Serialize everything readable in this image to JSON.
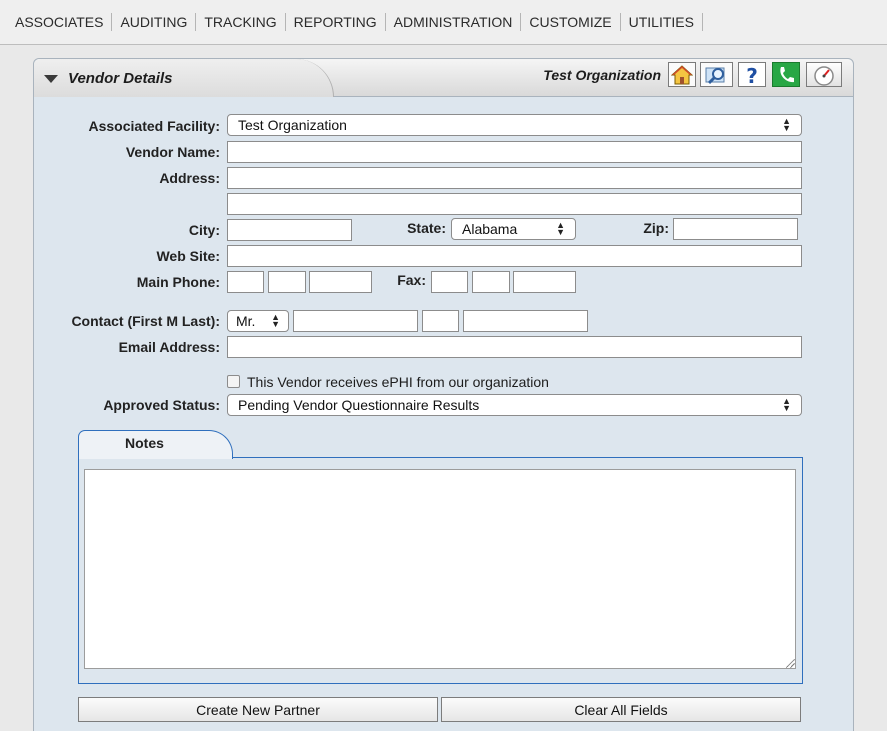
{
  "nav": {
    "items": [
      "ASSOCIATES",
      "AUDITING",
      "TRACKING",
      "REPORTING",
      "ADMINISTRATION",
      "CUSTOMIZE",
      "UTILITIES"
    ]
  },
  "panel": {
    "title": "Vendor Details",
    "organization": "Test Organization",
    "icons": [
      "home-icon",
      "search-icon",
      "help-icon",
      "phone-icon",
      "dashboard-icon"
    ]
  },
  "form": {
    "labels": {
      "facility": "Associated Facility:",
      "vendor_name": "Vendor Name:",
      "address": "Address:",
      "city": "City:",
      "state": "State:",
      "zip": "Zip:",
      "website": "Web Site:",
      "main_phone": "Main Phone:",
      "fax": "Fax:",
      "contact": "Contact (First M Last):",
      "email": "Email Address:",
      "approved_status": "Approved Status:"
    },
    "facility_value": "Test Organization",
    "state_value": "Alabama",
    "salutation_value": "Mr.",
    "ephi_checkbox_label": "This Vendor receives ePHI from our organization",
    "ephi_checked": false,
    "approved_status_value": "Pending Vendor Questionnaire Results"
  },
  "notes": {
    "tab_label": "Notes",
    "value": ""
  },
  "buttons": {
    "create": "Create New Partner",
    "clear": "Clear All Fields"
  },
  "colors": {
    "panel_bg": "#dde6ee",
    "notes_border": "#2f6fbd",
    "phone_icon_bg": "#28a745"
  }
}
